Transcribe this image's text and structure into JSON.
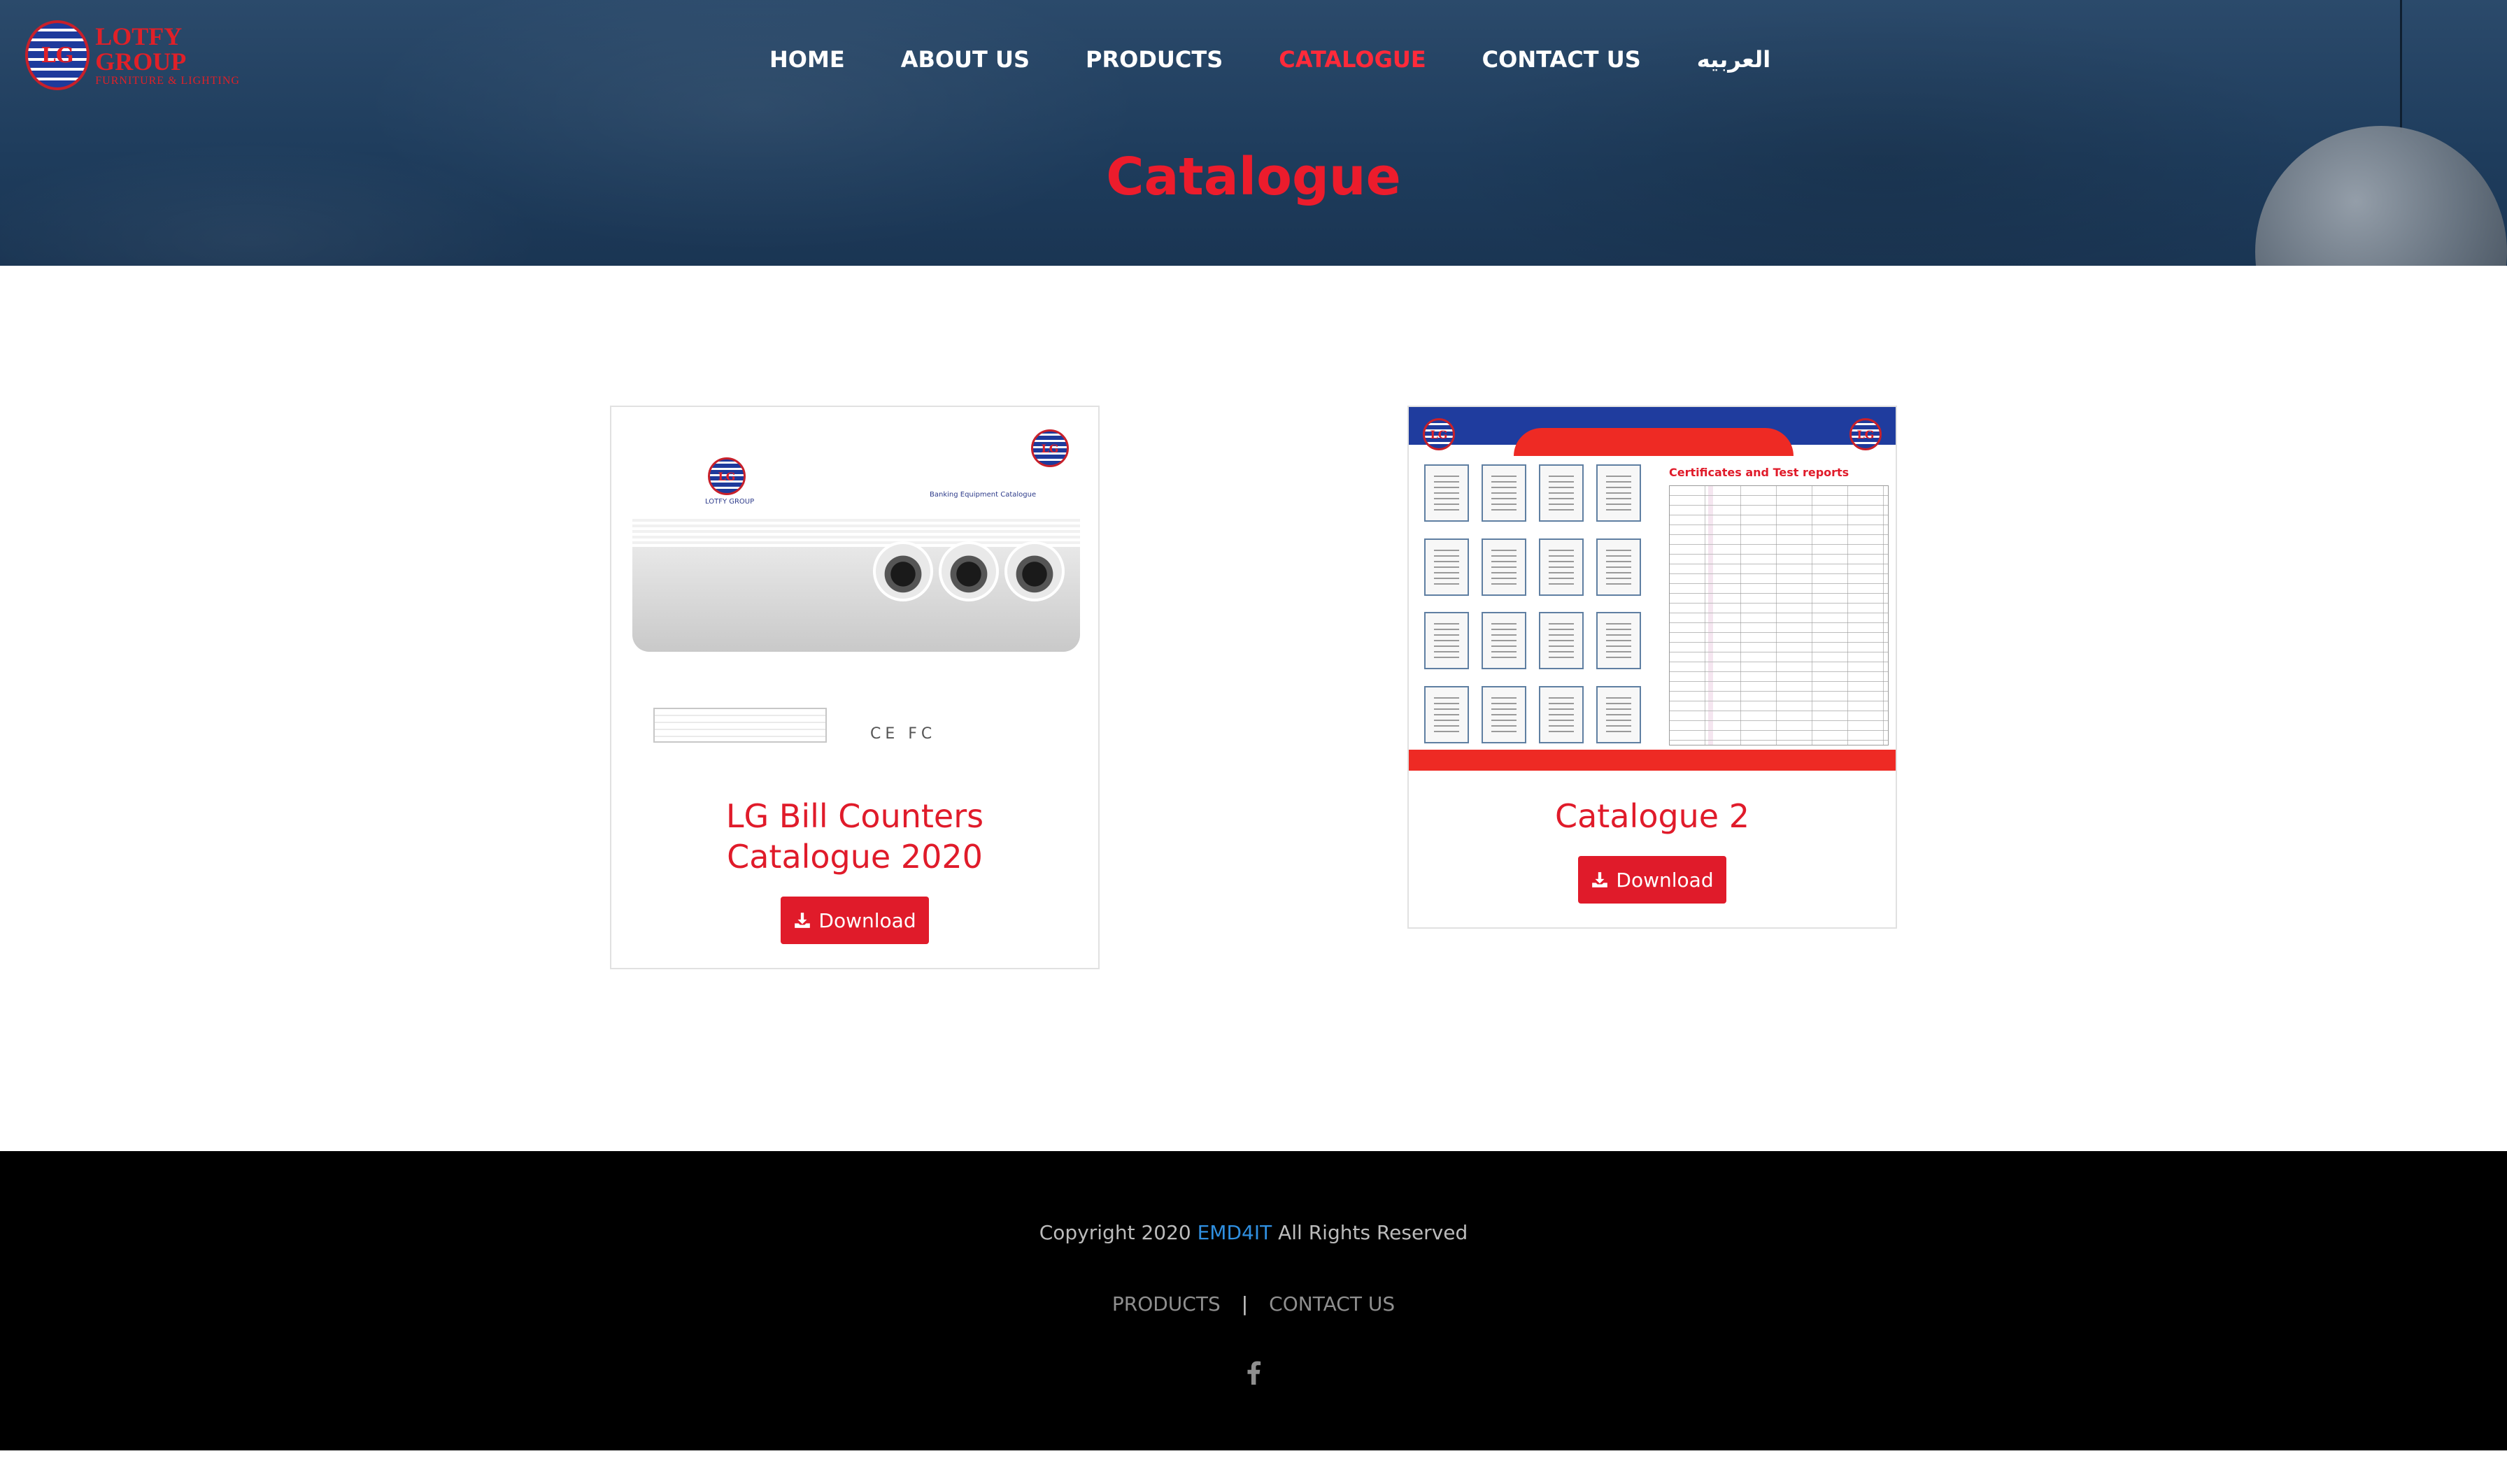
{
  "brand": {
    "logo_letters": "LG",
    "name": "LOTFY GROUP",
    "tagline": "FURNITURE & LIGHTING",
    "primary_color": "#e01b2a",
    "hero_color": "#1e3c5c"
  },
  "nav": {
    "items": [
      {
        "label": "HOME",
        "active": false
      },
      {
        "label": "ABOUT US",
        "active": false
      },
      {
        "label": "PRODUCTS",
        "active": false
      },
      {
        "label": "CATALOGUE",
        "active": true
      },
      {
        "label": "CONTACT US",
        "active": false
      },
      {
        "label": "العربيه",
        "active": false
      }
    ]
  },
  "page": {
    "title": "Catalogue"
  },
  "catalogues": [
    {
      "title_line1": "LG Bill Counters",
      "title_line2": "Catalogue 2020",
      "download_label": "Download",
      "thumb": {
        "logo_caption": "LOTFY GROUP",
        "subtitle": "Banking Equipment Catalogue",
        "cert_marks": "CE FC"
      }
    },
    {
      "title": "Catalogue 2",
      "download_label": "Download",
      "thumb": {
        "heading": "Certificates and Test reports"
      }
    }
  ],
  "footer": {
    "copyright_prefix": "Copyright 2020 ",
    "copyright_link": "EMD4IT",
    "copyright_suffix": " All Rights Reserved",
    "links": [
      {
        "label": "PRODUCTS"
      },
      {
        "label": "CONTACT US"
      }
    ],
    "separator": "|",
    "social": [
      "facebook-icon"
    ],
    "link_color": "#2f8fe0"
  }
}
